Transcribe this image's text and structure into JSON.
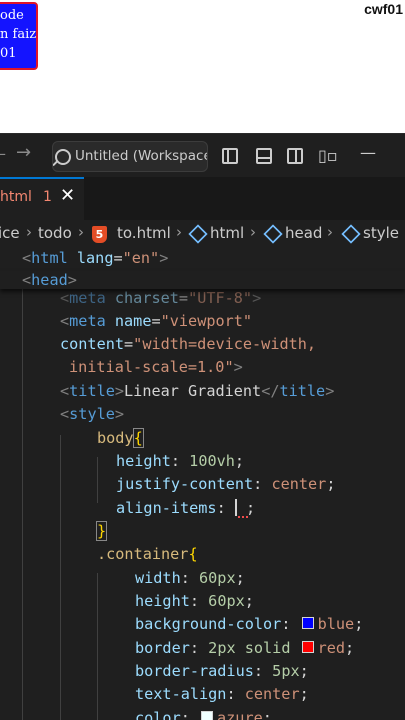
{
  "preview": {
    "box_lines": [
      "ode",
      "n faiz",
      "01"
    ],
    "channel": "cwf01"
  },
  "titlebar": {
    "search_text": "Untitled (Workspace"
  },
  "tab": {
    "name": "html",
    "problems": "1"
  },
  "breadcrumb": {
    "items": [
      "ice",
      "todo",
      "to.html",
      "html",
      "head",
      "style"
    ]
  },
  "code": {
    "sticky1": [
      "<",
      "html",
      " ",
      "lang",
      "=",
      "\"en\"",
      ">"
    ],
    "sticky2": [
      "<",
      "head",
      ">"
    ],
    "l0": [
      "<",
      "meta",
      " ",
      "charset",
      "=",
      "\"UTF-8\"",
      ">"
    ],
    "l1": [
      "<",
      "meta",
      " ",
      "name",
      "=",
      "\"viewport\""
    ],
    "l2": [
      "content",
      "=",
      "\"width=device-width,"
    ],
    "l3": [
      "initial-scale=1.0\"",
      ">"
    ],
    "l4": [
      "<",
      "title",
      ">",
      "Linear Gradient",
      "</",
      "title",
      ">"
    ],
    "l5": [
      "<",
      "style",
      ">"
    ],
    "l6": [
      "body",
      "{"
    ],
    "l7": [
      "height",
      ": ",
      "100vh",
      ";"
    ],
    "l8": [
      "justify-content",
      ": ",
      "center",
      ";"
    ],
    "l9": [
      "align-items",
      ": ",
      " ;"
    ],
    "l10": [
      "}"
    ],
    "l11": [
      ".container",
      "{"
    ],
    "l12": [
      "width",
      ": ",
      "60px",
      ";"
    ],
    "l13": [
      "height",
      ": ",
      "60px",
      ";"
    ],
    "l14": [
      "background-color",
      ": ",
      "blue",
      ";"
    ],
    "l15": [
      "border",
      ": ",
      "2px solid ",
      "red",
      ";"
    ],
    "l16": [
      "border-radius",
      ": ",
      "5px",
      ";"
    ],
    "l17": [
      "text-align",
      ": ",
      "center",
      ";"
    ],
    "l18": [
      "color",
      ": ",
      "azure",
      ";"
    ]
  },
  "colors": {
    "blue_swatch": "#0000ff",
    "red_swatch": "#ff0000",
    "azure_swatch": "#f0ffff"
  }
}
